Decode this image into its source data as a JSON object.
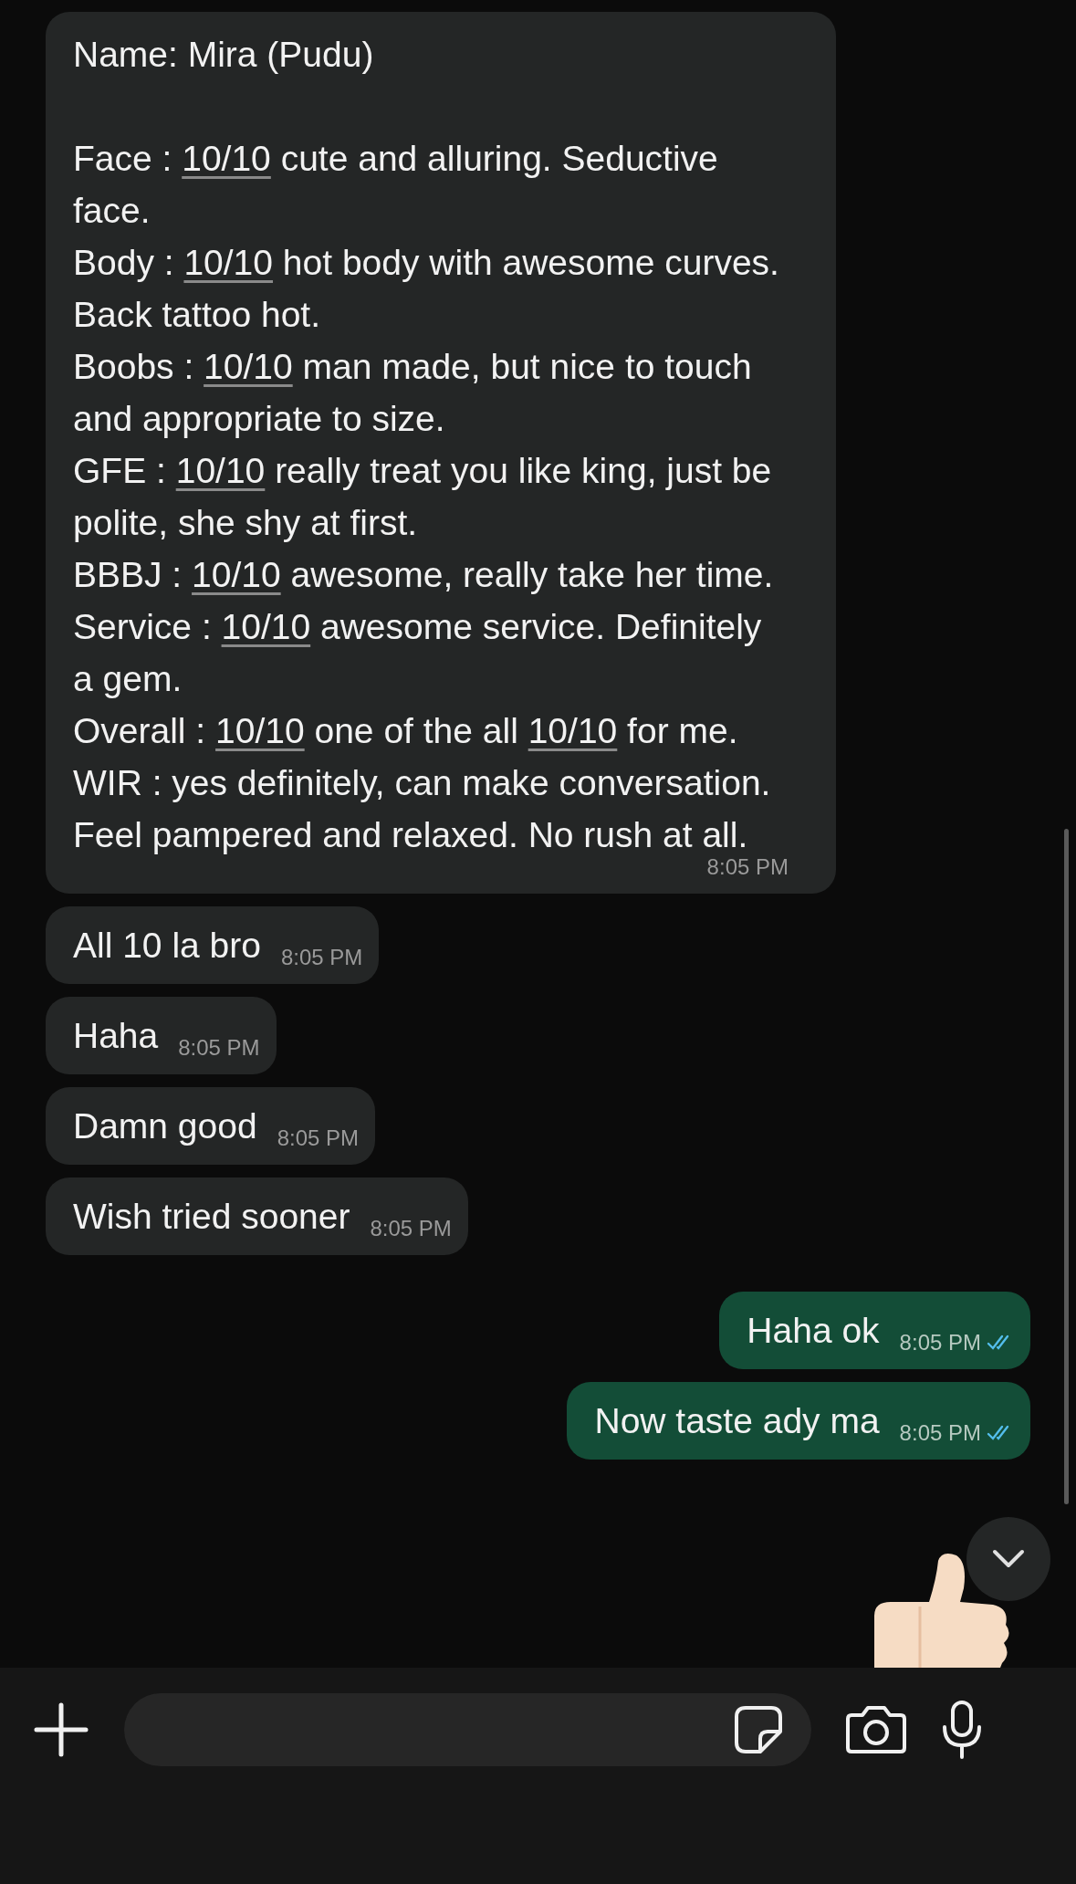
{
  "messages": [
    {
      "kind": "in",
      "paragraphs": [
        {
          "gap_after": true,
          "parts": [
            {
              "text": "Name: Mira (Pudu)"
            }
          ]
        },
        {
          "parts": [
            {
              "text": "Face : "
            },
            {
              "text": "10/10",
              "link": true
            },
            {
              "text": " cute and alluring. Seductive face."
            }
          ]
        },
        {
          "parts": [
            {
              "text": "Body : "
            },
            {
              "text": "10/10",
              "link": true
            },
            {
              "text": "  hot body with awesome curves. Back tattoo hot."
            }
          ]
        },
        {
          "parts": [
            {
              "text": "Boobs : "
            },
            {
              "text": "10/10",
              "link": true
            },
            {
              "text": " man made, but nice to touch and appropriate to size."
            }
          ]
        },
        {
          "parts": [
            {
              "text": "GFE : "
            },
            {
              "text": "10/10",
              "link": true
            },
            {
              "text": " really treat you like king, just be polite, she shy at first."
            }
          ]
        },
        {
          "parts": [
            {
              "text": "BBBJ : "
            },
            {
              "text": "10/10",
              "link": true
            },
            {
              "text": " awesome, really take her time."
            }
          ]
        },
        {
          "parts": [
            {
              "text": "Service : "
            },
            {
              "text": "10/10",
              "link": true
            },
            {
              "text": " awesome service. Definitely a gem."
            }
          ]
        },
        {
          "parts": [
            {
              "text": "Overall : "
            },
            {
              "text": "10/10",
              "link": true
            },
            {
              "text": " one of the all "
            },
            {
              "text": "10/10",
              "link": true
            },
            {
              "text": " for me."
            }
          ]
        },
        {
          "parts": [
            {
              "text": "WIR : yes definitely, can make conversation. Feel pampered and relaxed. No rush at all."
            }
          ]
        }
      ],
      "time": "8:05 PM"
    },
    {
      "kind": "in",
      "paragraphs": [
        {
          "parts": [
            {
              "text": "All 10 la bro"
            }
          ]
        }
      ],
      "time": "8:05 PM"
    },
    {
      "kind": "in",
      "paragraphs": [
        {
          "parts": [
            {
              "text": "Haha"
            }
          ]
        }
      ],
      "time": "8:05 PM"
    },
    {
      "kind": "in",
      "paragraphs": [
        {
          "parts": [
            {
              "text": "Damn good"
            }
          ]
        }
      ],
      "time": "8:05 PM"
    },
    {
      "kind": "in",
      "paragraphs": [
        {
          "parts": [
            {
              "text": "Wish tried sooner"
            }
          ]
        }
      ],
      "time": "8:05 PM"
    },
    {
      "kind": "out",
      "paragraphs": [
        {
          "parts": [
            {
              "text": "Haha ok"
            }
          ]
        }
      ],
      "time": "8:05 PM",
      "read": true
    },
    {
      "kind": "out",
      "paragraphs": [
        {
          "parts": [
            {
              "text": "Now taste ady ma"
            }
          ]
        }
      ],
      "time": "8:05 PM",
      "read": true
    }
  ]
}
